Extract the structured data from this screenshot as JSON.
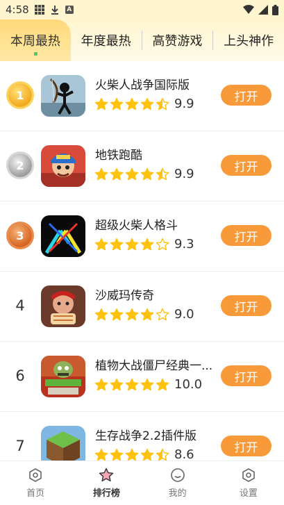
{
  "status_bar": {
    "time": "4:58",
    "icons": [
      "grid-icon",
      "download-icon",
      "a-icon",
      "wifi-icon",
      "signal-icon",
      "battery-icon"
    ]
  },
  "tabs": [
    {
      "label": "本周最热",
      "active": true
    },
    {
      "label": "年度最热",
      "active": false
    },
    {
      "label": "高赞游戏",
      "active": false
    },
    {
      "label": "上头神作",
      "active": false
    }
  ],
  "colors": {
    "accent": "#f89a39",
    "star": "#ffc20e",
    "tab_active": "#ffd97a",
    "header_bg": "#fff5cf"
  },
  "apps": [
    {
      "rank": "1",
      "rank_style": "gold",
      "name": "火柴人战争国际版",
      "rating": 4.5,
      "score": "9.9",
      "button": "打开",
      "icon": "stickman-war-icon"
    },
    {
      "rank": "2",
      "rank_style": "silver",
      "name": "地铁跑酷",
      "rating": 4.5,
      "score": "9.9",
      "button": "打开",
      "icon": "subway-surfers-icon"
    },
    {
      "rank": "3",
      "rank_style": "bronze",
      "name": "超级火柴人格斗",
      "rating": 4,
      "score": "9.3",
      "button": "打开",
      "icon": "stickman-fight-icon"
    },
    {
      "rank": "4",
      "rank_style": "plain",
      "name": "沙威玛传奇",
      "rating": 4,
      "score": "9.0",
      "button": "打开",
      "icon": "shawarma-icon"
    },
    {
      "rank": "6",
      "rank_style": "plain",
      "name": "植物大战僵尸经典一...",
      "rating": 5,
      "score": "10.0",
      "button": "打开",
      "icon": "pvz-icon"
    },
    {
      "rank": "7",
      "rank_style": "plain",
      "name": "生存战争2.2插件版",
      "rating": 4.5,
      "score": "8.6",
      "button": "打开",
      "icon": "survivalcraft-icon"
    }
  ],
  "bottom_nav": [
    {
      "label": "首页",
      "icon": "home-icon",
      "active": false
    },
    {
      "label": "排行榜",
      "icon": "star-rank-icon",
      "active": true
    },
    {
      "label": "我的",
      "icon": "smile-icon",
      "active": false
    },
    {
      "label": "设置",
      "icon": "settings-icon",
      "active": false
    }
  ]
}
